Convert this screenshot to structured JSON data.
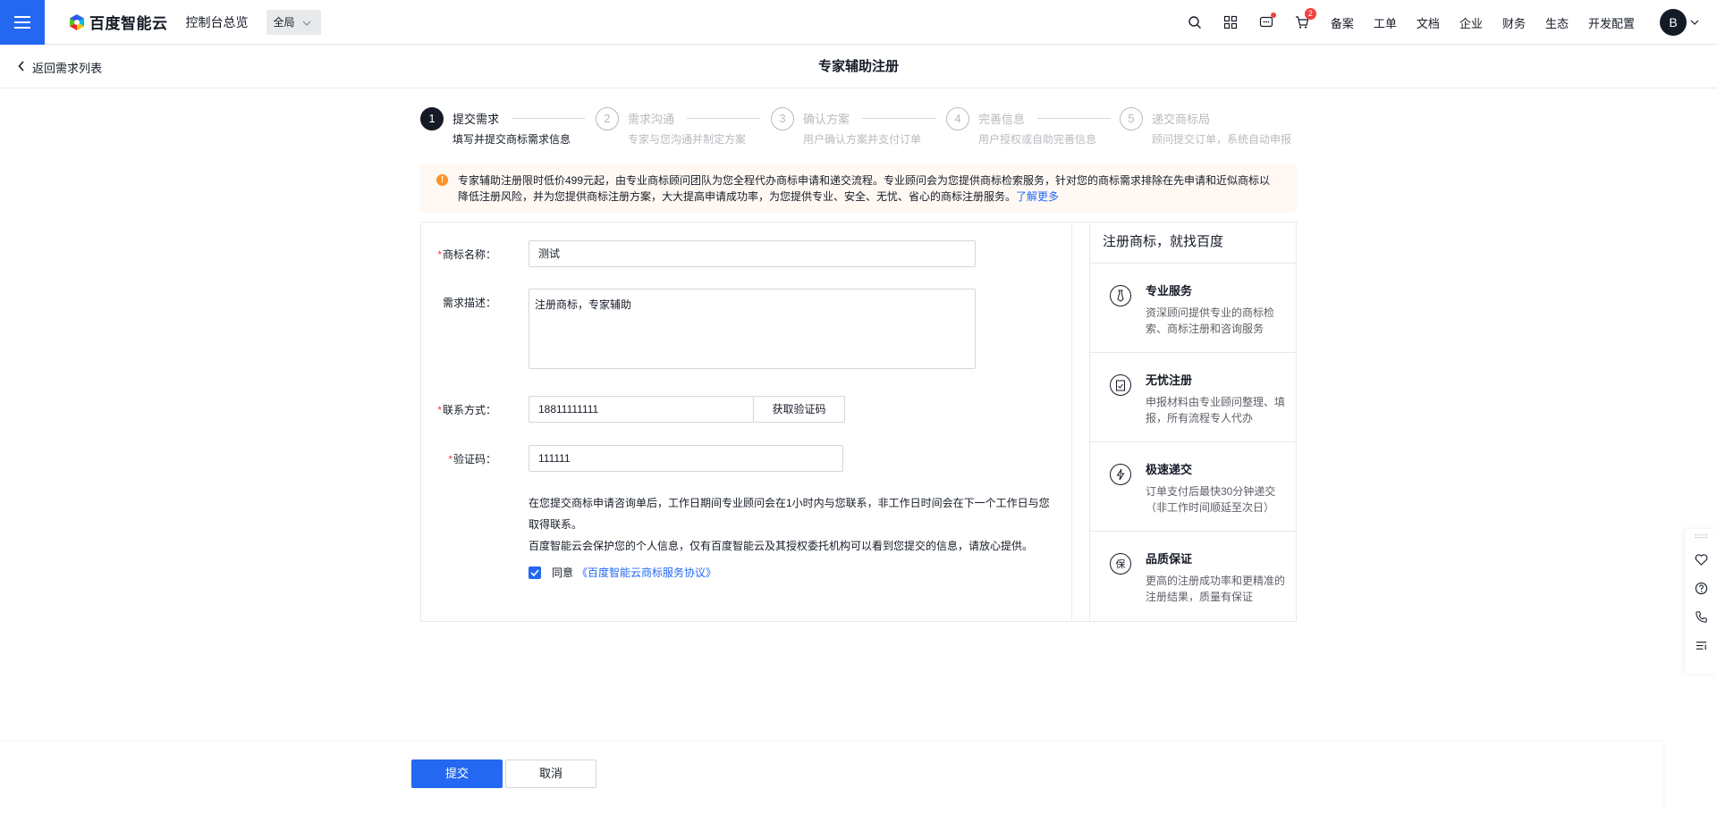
{
  "header": {
    "logo_text": "百度智能云",
    "console_link": "控制台总览",
    "region": "全局",
    "cart_count": "2",
    "links": [
      "备案",
      "工单",
      "文档",
      "企业",
      "财务",
      "生态",
      "开发配置"
    ],
    "avatar_letter": "B"
  },
  "subheader": {
    "back_label": "返回需求列表",
    "title": "专家辅助注册"
  },
  "steps": [
    {
      "num": "1",
      "title": "提交需求",
      "desc": "填写并提交商标需求信息"
    },
    {
      "num": "2",
      "title": "需求沟通",
      "desc": "专家与您沟通并制定方案"
    },
    {
      "num": "3",
      "title": "确认方案",
      "desc": "用户确认方案并支付订单"
    },
    {
      "num": "4",
      "title": "完善信息",
      "desc": "用户授权或自助完善信息"
    },
    {
      "num": "5",
      "title": "递交商标局",
      "desc": "顾问提交订单，系统自动申报"
    }
  ],
  "notice": {
    "icon": "!",
    "text": "专家辅助注册限时低价499元起，由专业商标顾问团队为您全程代办商标申请和递交流程。专业顾问会为您提供商标检索服务，针对您的商标需求排除在先申请和近似商标以降低注册风险，并为您提供商标注册方案，大大提高申请成功率，为您提供专业、安全、无忧、省心的商标注册服务。",
    "link": "了解更多"
  },
  "form": {
    "required_mark": "*",
    "name_label": "商标名称：",
    "name_value": "测试",
    "desc_label": "需求描述：",
    "desc_value": "注册商标，专家辅助",
    "phone_label": "联系方式：",
    "phone_value": "18811111111",
    "code_button": "获取验证码",
    "code_label": "验证码：",
    "code_value": "111111",
    "hint1": "在您提交商标申请咨询单后，工作日期间专业顾问会在1小时内与您联系，非工作日时间会在下一个工作日与您取得联系。",
    "hint2": "百度智能云会保护您的个人信息，仅有百度智能云及其授权委托机构可以看到您提交的信息，请放心提供。",
    "agree_label": "同意",
    "agree_link": "《百度智能云商标服务协议》"
  },
  "sidebar": {
    "title": "注册商标，就找百度",
    "features": [
      {
        "title": "专业服务",
        "desc": "资深顾问提供专业的商标检索、商标注册和咨询服务",
        "icon": "tie-icon"
      },
      {
        "title": "无忧注册",
        "desc": "申报材料由专业顾问整理、填报，所有流程专人代办",
        "icon": "clipboard-check-icon"
      },
      {
        "title": "极速递交",
        "desc": "订单支付后最快30分钟递交（非工作时间顺延至次日）",
        "icon": "lightning-icon"
      },
      {
        "title": "品质保证",
        "desc": "更高的注册成功率和更精准的注册结果，质量有保证",
        "icon": "guarantee-icon",
        "icon_glyph": "保"
      }
    ]
  },
  "footer": {
    "submit": "提交",
    "cancel": "取消"
  },
  "colors": {
    "primary": "#2468f2",
    "text": "#151b26",
    "muted": "#b8babf",
    "notice_bg": "#fff8f3",
    "warning": "#ff9326",
    "danger": "#f33e3e"
  }
}
